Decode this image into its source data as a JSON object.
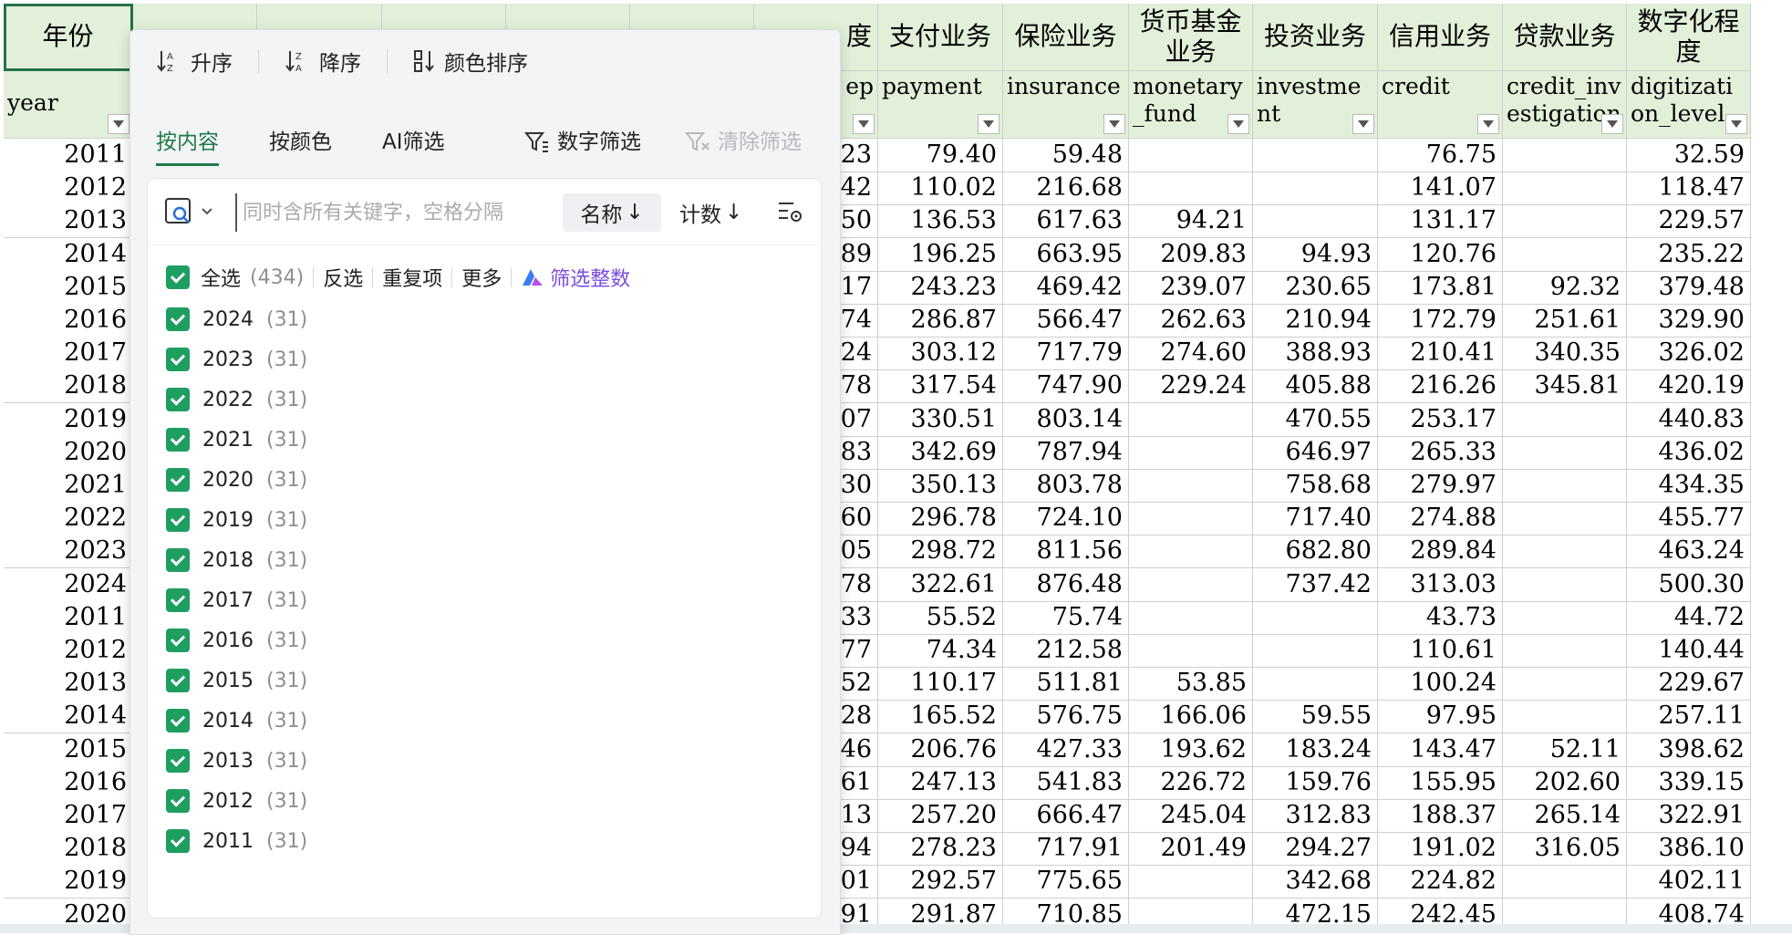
{
  "sheet": {
    "header_row1": [
      "年份",
      "",
      "",
      "",
      "",
      "",
      "",
      "支付业务",
      "保险业务",
      "货币基金业务",
      "投资业务",
      "信用业务",
      "贷款业务",
      "数字化程度"
    ],
    "header_row1_hidden_fragment": "度",
    "header_row2": [
      "year",
      "",
      "",
      "",
      "",
      "",
      "ep",
      "payment",
      "insurance",
      "monetary_fund",
      "investment",
      "credit",
      "credit_investigation",
      "digitization_level"
    ],
    "rows": [
      {
        "year": "2011",
        "c6": "23",
        "payment": "79.40",
        "insurance": "59.48",
        "monetary_fund": "",
        "investment": "",
        "credit": "76.75",
        "credit_investigation": "",
        "digitization_level": "32.59"
      },
      {
        "year": "2012",
        "c6": "42",
        "payment": "110.02",
        "insurance": "216.68",
        "monetary_fund": "",
        "investment": "",
        "credit": "141.07",
        "credit_investigation": "",
        "digitization_level": "118.47"
      },
      {
        "year": "2013",
        "c6": "50",
        "payment": "136.53",
        "insurance": "617.63",
        "monetary_fund": "94.21",
        "investment": "",
        "credit": "131.17",
        "credit_investigation": "",
        "digitization_level": "229.57"
      },
      {
        "year": "2014",
        "c6": "89",
        "payment": "196.25",
        "insurance": "663.95",
        "monetary_fund": "209.83",
        "investment": "94.93",
        "credit": "120.76",
        "credit_investigation": "",
        "digitization_level": "235.22"
      },
      {
        "year": "2015",
        "c6": "17",
        "payment": "243.23",
        "insurance": "469.42",
        "monetary_fund": "239.07",
        "investment": "230.65",
        "credit": "173.81",
        "credit_investigation": "92.32",
        "digitization_level": "379.48"
      },
      {
        "year": "2016",
        "c6": "74",
        "payment": "286.87",
        "insurance": "566.47",
        "monetary_fund": "262.63",
        "investment": "210.94",
        "credit": "172.79",
        "credit_investigation": "251.61",
        "digitization_level": "329.90"
      },
      {
        "year": "2017",
        "c6": "24",
        "payment": "303.12",
        "insurance": "717.79",
        "monetary_fund": "274.60",
        "investment": "388.93",
        "credit": "210.41",
        "credit_investigation": "340.35",
        "digitization_level": "326.02"
      },
      {
        "year": "2018",
        "c6": "78",
        "payment": "317.54",
        "insurance": "747.90",
        "monetary_fund": "229.24",
        "investment": "405.88",
        "credit": "216.26",
        "credit_investigation": "345.81",
        "digitization_level": "420.19"
      },
      {
        "year": "2019",
        "c6": "07",
        "payment": "330.51",
        "insurance": "803.14",
        "monetary_fund": "",
        "investment": "470.55",
        "credit": "253.17",
        "credit_investigation": "",
        "digitization_level": "440.83"
      },
      {
        "year": "2020",
        "c6": "83",
        "payment": "342.69",
        "insurance": "787.94",
        "monetary_fund": "",
        "investment": "646.97",
        "credit": "265.33",
        "credit_investigation": "",
        "digitization_level": "436.02"
      },
      {
        "year": "2021",
        "c6": "30",
        "payment": "350.13",
        "insurance": "803.78",
        "monetary_fund": "",
        "investment": "758.68",
        "credit": "279.97",
        "credit_investigation": "",
        "digitization_level": "434.35"
      },
      {
        "year": "2022",
        "c6": "60",
        "payment": "296.78",
        "insurance": "724.10",
        "monetary_fund": "",
        "investment": "717.40",
        "credit": "274.88",
        "credit_investigation": "",
        "digitization_level": "455.77"
      },
      {
        "year": "2023",
        "c6": "05",
        "payment": "298.72",
        "insurance": "811.56",
        "monetary_fund": "",
        "investment": "682.80",
        "credit": "289.84",
        "credit_investigation": "",
        "digitization_level": "463.24"
      },
      {
        "year": "2024",
        "c6": "78",
        "payment": "322.61",
        "insurance": "876.48",
        "monetary_fund": "",
        "investment": "737.42",
        "credit": "313.03",
        "credit_investigation": "",
        "digitization_level": "500.30"
      },
      {
        "year": "2011",
        "c6": "33",
        "payment": "55.52",
        "insurance": "75.74",
        "monetary_fund": "",
        "investment": "",
        "credit": "43.73",
        "credit_investigation": "",
        "digitization_level": "44.72"
      },
      {
        "year": "2012",
        "c6": "77",
        "payment": "74.34",
        "insurance": "212.58",
        "monetary_fund": "",
        "investment": "",
        "credit": "110.61",
        "credit_investigation": "",
        "digitization_level": "140.44"
      },
      {
        "year": "2013",
        "c6": "52",
        "payment": "110.17",
        "insurance": "511.81",
        "monetary_fund": "53.85",
        "investment": "",
        "credit": "100.24",
        "credit_investigation": "",
        "digitization_level": "229.67"
      },
      {
        "year": "2014",
        "c6": "28",
        "payment": "165.52",
        "insurance": "576.75",
        "monetary_fund": "166.06",
        "investment": "59.55",
        "credit": "97.95",
        "credit_investigation": "",
        "digitization_level": "257.11"
      },
      {
        "year": "2015",
        "c6": "46",
        "payment": "206.76",
        "insurance": "427.33",
        "monetary_fund": "193.62",
        "investment": "183.24",
        "credit": "143.47",
        "credit_investigation": "52.11",
        "digitization_level": "398.62"
      },
      {
        "year": "2016",
        "c6": "61",
        "payment": "247.13",
        "insurance": "541.83",
        "monetary_fund": "226.72",
        "investment": "159.76",
        "credit": "155.95",
        "credit_investigation": "202.60",
        "digitization_level": "339.15"
      },
      {
        "year": "2017",
        "c6": "13",
        "payment": "257.20",
        "insurance": "666.47",
        "monetary_fund": "245.04",
        "investment": "312.83",
        "credit": "188.37",
        "credit_investigation": "265.14",
        "digitization_level": "322.91"
      },
      {
        "year": "2018",
        "c6": "94",
        "payment": "278.23",
        "insurance": "717.91",
        "monetary_fund": "201.49",
        "investment": "294.27",
        "credit": "191.02",
        "credit_investigation": "316.05",
        "digitization_level": "386.10"
      },
      {
        "year": "2019",
        "c6": "01",
        "payment": "292.57",
        "insurance": "775.65",
        "monetary_fund": "",
        "investment": "342.68",
        "credit": "224.82",
        "credit_investigation": "",
        "digitization_level": "402.11"
      },
      {
        "year": "2020",
        "c6": "91",
        "payment": "291.87",
        "insurance": "710.85",
        "monetary_fund": "",
        "investment": "472.15",
        "credit": "242.45",
        "credit_investigation": "",
        "digitization_level": "408.74"
      }
    ]
  },
  "filter": {
    "sort": {
      "asc": "升序",
      "desc": "降序",
      "by_color": "颜色排序"
    },
    "tabs": {
      "by_content": "按内容",
      "by_color": "按颜色",
      "ai_filter": "AI筛选",
      "number_filter": "数字筛选",
      "clear_filter": "清除筛选"
    },
    "search": {
      "placeholder": "同时含所有关键字，空格分隔",
      "value": ""
    },
    "name_sort": "名称",
    "count_sort": "计数",
    "select_all": "全选",
    "select_all_count": "(434)",
    "invert": "反选",
    "duplicates": "重复项",
    "more": "更多",
    "ai_integer": "筛选整数",
    "items": [
      {
        "label": "2024",
        "count": "(31)"
      },
      {
        "label": "2023",
        "count": "(31)"
      },
      {
        "label": "2022",
        "count": "(31)"
      },
      {
        "label": "2021",
        "count": "(31)"
      },
      {
        "label": "2020",
        "count": "(31)"
      },
      {
        "label": "2019",
        "count": "(31)"
      },
      {
        "label": "2018",
        "count": "(31)"
      },
      {
        "label": "2017",
        "count": "(31)"
      },
      {
        "label": "2016",
        "count": "(31)"
      },
      {
        "label": "2015",
        "count": "(31)"
      },
      {
        "label": "2014",
        "count": "(31)"
      },
      {
        "label": "2013",
        "count": "(31)"
      },
      {
        "label": "2012",
        "count": "(31)"
      },
      {
        "label": "2011",
        "count": "(31)"
      }
    ]
  },
  "colors": {
    "accent": "#1f7a4a",
    "checkbox": "#1f9e62",
    "header_bg": "#e2f0d9",
    "ai": "#7a4ce0"
  }
}
